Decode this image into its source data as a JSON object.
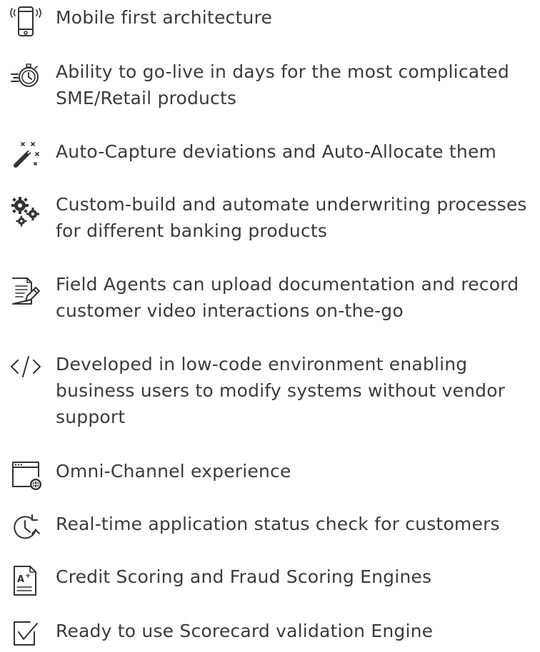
{
  "features": [
    {
      "icon": "mobile-phone-icon",
      "text": "Mobile first architecture"
    },
    {
      "icon": "stopwatch-icon",
      "text": "Ability to go-live in days for the most complicated SME/Retail products"
    },
    {
      "icon": "magic-wand-icon",
      "text": "Auto-Capture deviations and Auto-Allocate them"
    },
    {
      "icon": "gears-icon",
      "text": "Custom-build and automate underwriting processes for different banking products"
    },
    {
      "icon": "document-edit-icon",
      "text": "Field Agents can upload documentation and record customer video interactions on-the-go"
    },
    {
      "icon": "code-icon",
      "text": "Developed in low-code environment enabling business users to modify systems without vendor support"
    },
    {
      "icon": "browser-globe-icon",
      "text": "Omni-Channel experience"
    },
    {
      "icon": "clock-refresh-icon",
      "text": "Real-time application status check for customers"
    },
    {
      "icon": "grade-document-icon",
      "text": "Credit Scoring and Fraud Scoring Engines"
    },
    {
      "icon": "checkbox-icon",
      "text": "Ready to use Scorecard validation Engine"
    }
  ]
}
